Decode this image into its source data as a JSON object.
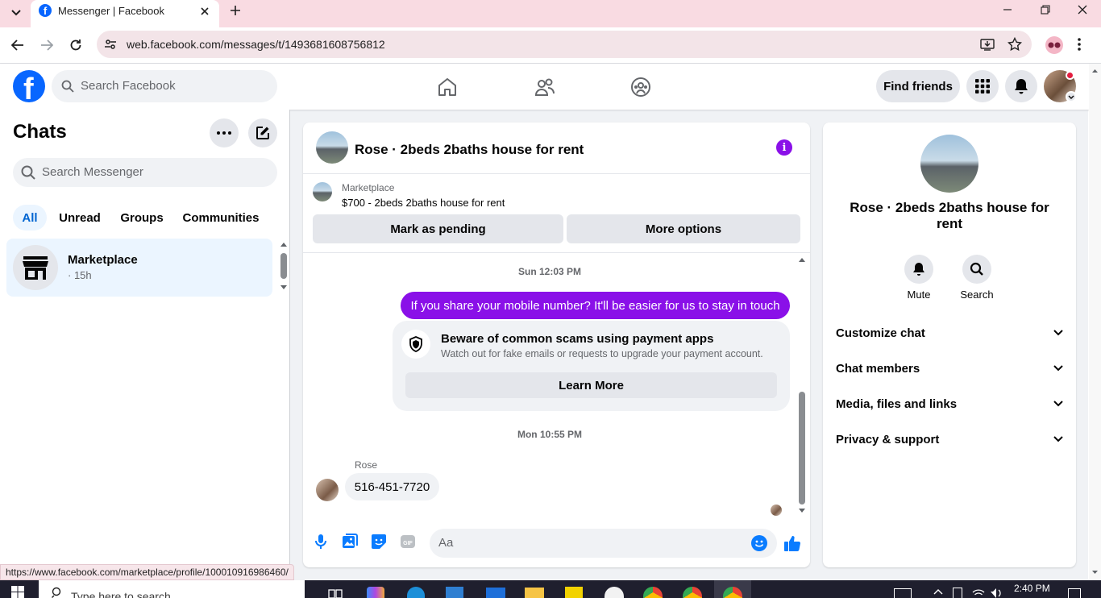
{
  "browser": {
    "tab_title": "Messenger | Facebook",
    "url": "web.facebook.com/messages/t/1493681608756812",
    "status_url": "https://www.facebook.com/marketplace/profile/100010916986460/"
  },
  "header": {
    "search_placeholder": "Search Facebook",
    "find_friends": "Find friends"
  },
  "chats": {
    "title": "Chats",
    "search_placeholder": "Search Messenger",
    "filters": [
      "All",
      "Unread",
      "Groups",
      "Communities"
    ],
    "items": [
      {
        "name": "Marketplace",
        "meta": "· 15h"
      }
    ]
  },
  "conversation": {
    "title": "Rose · 2beds 2baths house for rent",
    "listing_source": "Marketplace",
    "listing_title": "$700 - 2beds 2baths house for rent",
    "mark_pending": "Mark as pending",
    "more_options": "More options",
    "timestamp1": "Sun 12:03 PM",
    "sent_message": "If you share your mobile number? It'll be easier for us to stay in touch",
    "scam_title": "Beware of common scams using payment apps",
    "scam_body": "Watch out for fake emails or requests to upgrade your payment account.",
    "learn_more": "Learn More",
    "timestamp2": "Mon 10:55 PM",
    "sender_name": "Rose",
    "received_message": "516-451-7720",
    "composer_placeholder": "Aa"
  },
  "details": {
    "title": "Rose · 2beds 2baths house for rent",
    "actions": [
      "Mute",
      "Search"
    ],
    "sections": [
      "Customize chat",
      "Chat members",
      "Media, files and links",
      "Privacy & support"
    ]
  },
  "taskbar": {
    "search_placeholder": "Type here to search",
    "time": "2:40 PM"
  },
  "colors": {
    "accent_purple": "#8a10e8",
    "fb_blue": "#0866ff",
    "messenger_blue": "#0a7cff",
    "tab_strip": "#f9dbe2"
  }
}
